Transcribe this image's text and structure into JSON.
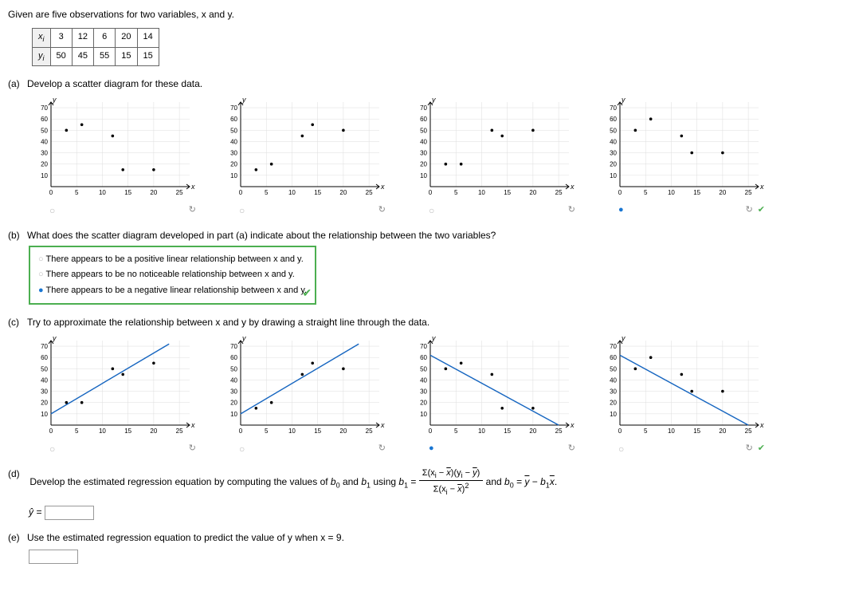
{
  "intro": "Given are five observations for two variables, x and y.",
  "table": {
    "rh1": "x",
    "rh2": "y",
    "sub": "i",
    "x": [
      "3",
      "12",
      "6",
      "20",
      "14"
    ],
    "y": [
      "50",
      "45",
      "55",
      "15",
      "15"
    ]
  },
  "a": {
    "label": "(a)",
    "text": "Develop a scatter diagram for these data."
  },
  "b": {
    "label": "(b)",
    "text": "What does the scatter diagram developed in part (a) indicate about the relationship between the two variables?",
    "opt1": "There appears to be a positive linear relationship between x and y.",
    "opt2": "There appears to be no noticeable relationship between x and y.",
    "opt3": "There appears to be a negative linear relationship between x and y."
  },
  "c": {
    "label": "(c)",
    "text": "Try to approximate the relationship between x and y by drawing a straight line through the data."
  },
  "d": {
    "label": "(d)",
    "text1": "Develop the estimated regression equation by computing the values of ",
    "b0": "b",
    "sub0": "0",
    "and": " and ",
    "b1": "b",
    "sub1": "1",
    "using": " using ",
    "eq": "b",
    "eqsub": "1",
    "eq2": " = ",
    "numtxt": "Σ(x",
    "numtxt2": " − ",
    "numtxt3": ")(y",
    "numtxt4": " − ",
    "numtxt5": ")",
    "dentxt": "Σ(x",
    "dentxt2": " − ",
    "dentxt3": ")",
    "densup": "2",
    "tail": " and ",
    "tailb": "b",
    "tailsub": "0",
    "taileq": " = ",
    "taily": "y",
    "tailm": " − ",
    "tailb1": "b",
    "tailb1sub": "1",
    "tailx": "x",
    "taildot": ".",
    "yhat": "ŷ = "
  },
  "e": {
    "label": "(e)",
    "text": "Use the estimated regression equation to predict the value of y when x = 9."
  },
  "axes": {
    "ylab": "y",
    "xlab": "x",
    "yticks": [
      "70",
      "60",
      "50",
      "40",
      "30",
      "20",
      "10"
    ],
    "xticks": [
      "0",
      "5",
      "10",
      "15",
      "20",
      "25"
    ]
  },
  "chart_data": [
    {
      "type": "scatter",
      "x": [
        3,
        12,
        6,
        20,
        14
      ],
      "y": [
        50,
        45,
        55,
        15,
        15
      ],
      "title": "option A (data)",
      "ylim": [
        0,
        75
      ],
      "xlim": [
        0,
        27
      ]
    },
    {
      "type": "scatter",
      "x": [
        3,
        6,
        12,
        14,
        20
      ],
      "y": [
        15,
        20,
        45,
        55,
        50
      ],
      "title": "option B",
      "ylim": [
        0,
        75
      ],
      "xlim": [
        0,
        27
      ]
    },
    {
      "type": "scatter",
      "x": [
        3,
        6,
        12,
        14,
        20
      ],
      "y": [
        20,
        20,
        50,
        45,
        50
      ],
      "title": "option C",
      "ylim": [
        0,
        75
      ],
      "xlim": [
        0,
        27
      ]
    },
    {
      "type": "scatter",
      "x": [
        3,
        6,
        12,
        14,
        20
      ],
      "y": [
        50,
        60,
        45,
        30,
        30
      ],
      "title": "option D",
      "ylim": [
        0,
        75
      ],
      "xlim": [
        0,
        27
      ]
    }
  ]
}
